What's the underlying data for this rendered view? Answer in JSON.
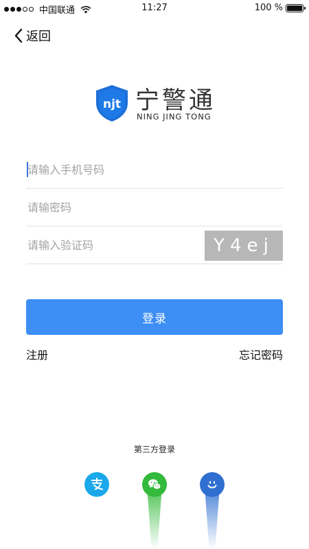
{
  "status_bar": {
    "carrier": "中国联通",
    "time": "11:27",
    "battery": "100 %",
    "battery_level": 1.0,
    "signal_bars_filled": 3,
    "signal_bars_total": 5
  },
  "nav": {
    "back_label": "返回"
  },
  "logo": {
    "title": "宁警通",
    "subtitle": "NING JING TONG",
    "badge_text": "njt"
  },
  "form": {
    "phone_placeholder": "请输入手机号码",
    "password_placeholder": "请输密码",
    "captcha_placeholder": "请输入验证码",
    "captcha_text": "Y4ej",
    "login_label": "登录",
    "register_label": "注册",
    "forgot_label": "忘记密码"
  },
  "third_party": {
    "title": "第三方登录",
    "providers": [
      {
        "icon": "alipay-icon",
        "color": "#1ba8ea"
      },
      {
        "icon": "wechat-icon",
        "color": "#33b93b"
      },
      {
        "icon": "qq-icon",
        "color": "#2e6fd0"
      }
    ]
  },
  "colors": {
    "accent": "#3d8ef5",
    "logo_blue": "#1e6fd9",
    "captcha_bg": "#b7b7b7"
  }
}
